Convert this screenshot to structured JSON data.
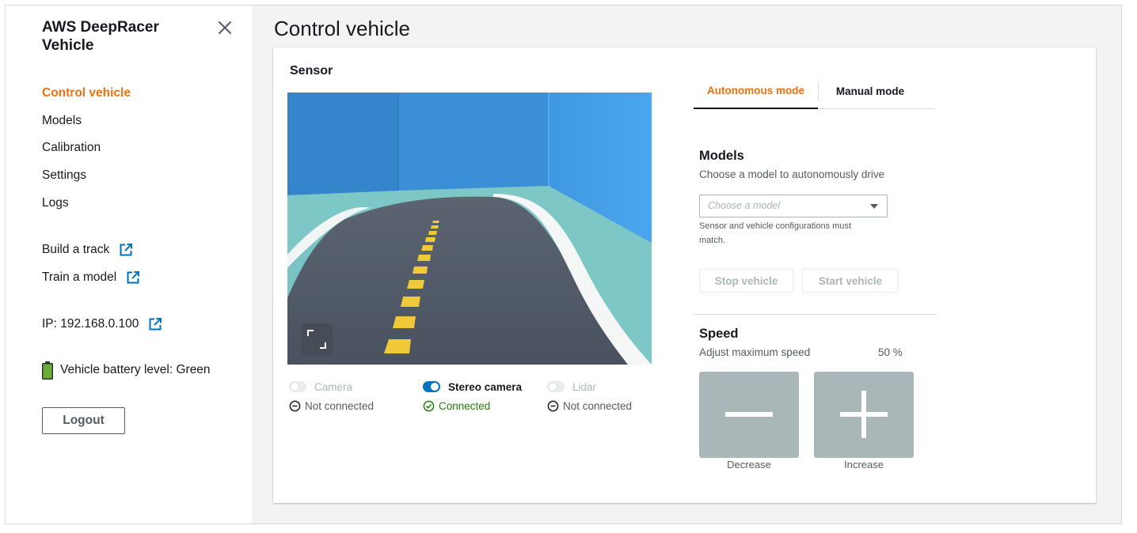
{
  "sidebar": {
    "brand": "AWS DeepRacer Vehicle",
    "nav": [
      {
        "label": "Control vehicle",
        "active": true
      },
      {
        "label": "Models",
        "active": false
      },
      {
        "label": "Calibration",
        "active": false
      },
      {
        "label": "Settings",
        "active": false
      },
      {
        "label": "Logs",
        "active": false
      }
    ],
    "external_links": [
      {
        "label": "Build a track",
        "icon": "external-link-icon"
      },
      {
        "label": "Train a model",
        "icon": "external-link-icon"
      }
    ],
    "ip": "IP: 192.168.0.100",
    "battery": "Vehicle battery level: Green",
    "logout": "Logout"
  },
  "page": {
    "title": "Control vehicle"
  },
  "sensor": {
    "title": "Sensor",
    "sensors": [
      {
        "label": "Camera",
        "enabled": false,
        "status": "Not connected",
        "connected": false
      },
      {
        "label": "Stereo camera",
        "enabled": true,
        "status": "Connected",
        "connected": true
      },
      {
        "label": "Lidar",
        "enabled": false,
        "status": "Not connected",
        "connected": false
      }
    ]
  },
  "tabs": [
    {
      "label": "Autonomous mode",
      "active": true
    },
    {
      "label": "Manual mode",
      "active": false
    }
  ],
  "models": {
    "title": "Models",
    "description": "Choose a model to autonomously drive",
    "placeholder": "Choose a model",
    "hint": "Sensor and vehicle configurations must match.",
    "stop_label": "Stop vehicle",
    "start_label": "Start vehicle"
  },
  "speed": {
    "title": "Speed",
    "description": "Adjust maximum speed",
    "value": "50 %",
    "decrease_label": "Decrease",
    "increase_label": "Increase"
  },
  "colors": {
    "accent": "#ec7211",
    "link_blue": "#0073bb",
    "success": "#1d8102",
    "battery_green": "#6aaf35"
  }
}
